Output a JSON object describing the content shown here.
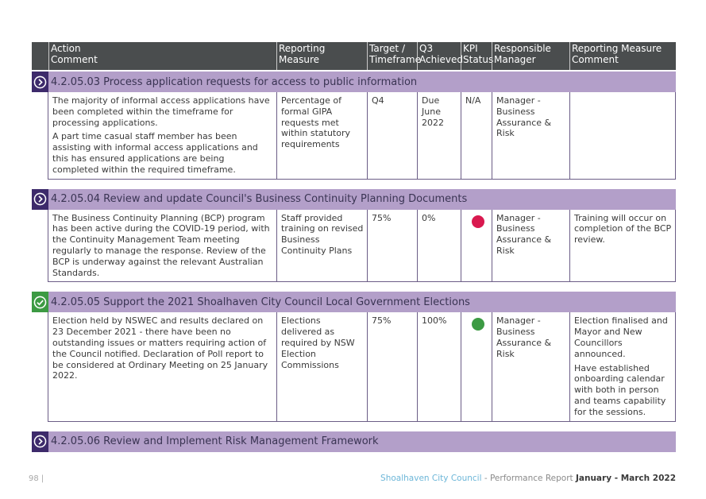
{
  "header": {
    "columns": [
      "Action\nComment",
      "Reporting\nMeasure",
      "Target /\nTimeframe",
      "Q3\nAchieved",
      "KPI\nStatus",
      "Responsible\nManager",
      "Reporting Measure\nComment"
    ]
  },
  "colors": {
    "header_bg": "#4a4d4e",
    "section_bg": "#b39fc9",
    "icon_in_progress": "#3d2a6b",
    "icon_complete": "#3c9a43",
    "kpi_red": "#d9194f",
    "kpi_green": "#3c9a43"
  },
  "sections": [
    {
      "icon": "chevron-right-circle-icon",
      "status": "in-progress",
      "title": "4.2.05.03 Process application requests for access to public information",
      "row": {
        "comment": [
          "The majority of informal access applications have been completed within the timeframe for processing applications.",
          "A part time casual staff member has been assisting with informal access applications and this has ensured applications are being completed within the required timeframe."
        ],
        "measure": "Percentage of formal GIPA requests met within statutory requirements",
        "target": "Q4",
        "achieved": "Due June 2022",
        "kpi_status": "N/A",
        "manager": "Manager - Business Assurance & Risk",
        "measure_comment": []
      }
    },
    {
      "icon": "chevron-right-circle-icon",
      "status": "in-progress",
      "title": "4.2.05.04 Review and update Council's Business Continuity Planning Documents",
      "row": {
        "comment": [
          "The Business Continuity Planning (BCP) program has been active during the COVID-19 period, with the Continuity Management Team meeting regularly to manage the response. Review of the BCP is underway against the relevant Australian Standards."
        ],
        "measure": "Staff provided training on revised Business Continuity Plans",
        "target": "75%",
        "achieved": "0%",
        "kpi_status": "red",
        "manager": "Manager - Business Assurance & Risk",
        "measure_comment": [
          "Training will occur on completion of the BCP review."
        ]
      }
    },
    {
      "icon": "check-circle-icon",
      "status": "complete",
      "title": "4.2.05.05 Support the 2021 Shoalhaven City Council Local Government Elections",
      "row": {
        "comment": [
          "Election held by NSWEC and results declared on 23 December 2021 - there have been no outstanding issues or matters requiring action of the Council notified. Declaration of Poll report to be considered at Ordinary Meeting on 25 January 2022."
        ],
        "measure": "Elections delivered as required by NSW Election Commissions",
        "target": "75%",
        "achieved": "100%",
        "kpi_status": "green",
        "manager": "Manager - Business Assurance & Risk",
        "measure_comment": [
          "Election finalised and Mayor and New Councillors announced.",
          "Have established onboarding calendar with both in person and teams capability for the sessions."
        ]
      }
    },
    {
      "icon": "chevron-right-circle-icon",
      "status": "in-progress",
      "title": "4.2.05.06 Review and Implement Risk Management Framework"
    }
  ],
  "footer": {
    "page_number": "98",
    "separator": "|",
    "brand": "Shoalhaven City Council",
    "report": " - Performance Report ",
    "period": "January - March 2022"
  }
}
